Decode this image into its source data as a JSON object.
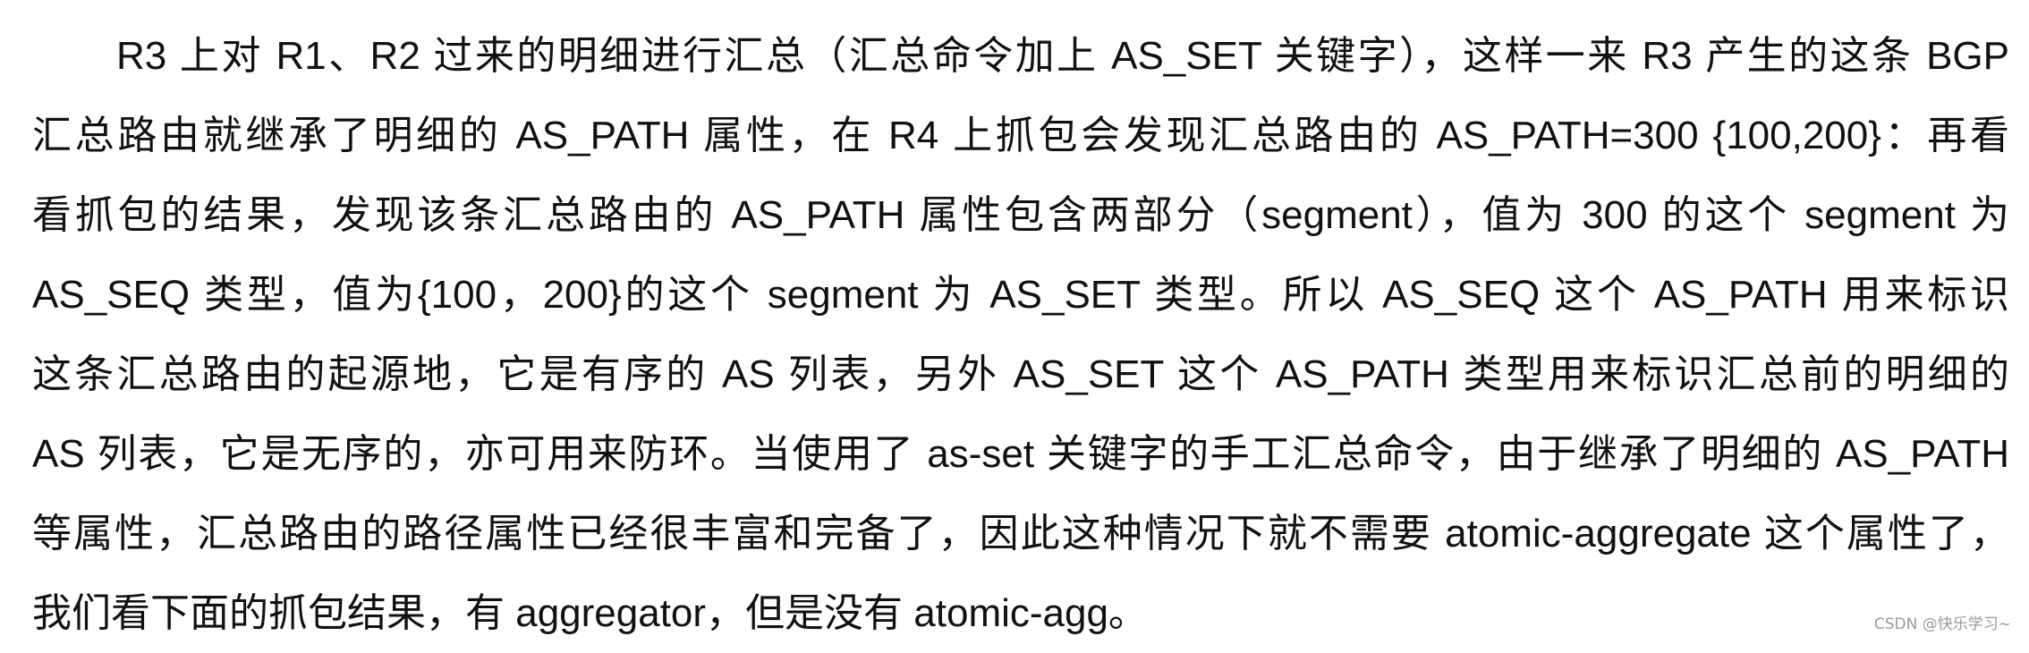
{
  "document": {
    "lines": [
      "R3 上对 R1、R2 过来的明细进行汇总（汇总命令加上 AS_SET 关键字），这样一来 R3 产生的这条 BGP",
      "汇总路由就继承了明细的 AS_PATH 属性，在 R4 上抓包会发现汇总路由的 AS_PATH=300 {100,200}：再看",
      "看抓包的结果，发现该条汇总路由的 AS_PATH 属性包含两部分（segment），值为 300 的这个 segment 为",
      "AS_SEQ 类型，值为{100，200}的这个 segment 为 AS_SET 类型。所以 AS_SEQ 这个 AS_PATH 用来标识",
      "这条汇总路由的起源地，它是有序的 AS 列表，另外 AS_SET 这个 AS_PATH 类型用来标识汇总前的明细的",
      "AS 列表，它是无序的，亦可用来防环。当使用了 as-set 关键字的手工汇总命令，由于继承了明细的 AS_PATH",
      "等属性，汇总路由的路径属性已经很丰富和完备了，因此这种情况下就不需要 atomic-aggregate 这个属性了，",
      "我们看下面的抓包结果，有 aggregator，但是没有 atomic-agg。"
    ]
  },
  "watermark": {
    "text": "CSDN @快乐学习~"
  }
}
